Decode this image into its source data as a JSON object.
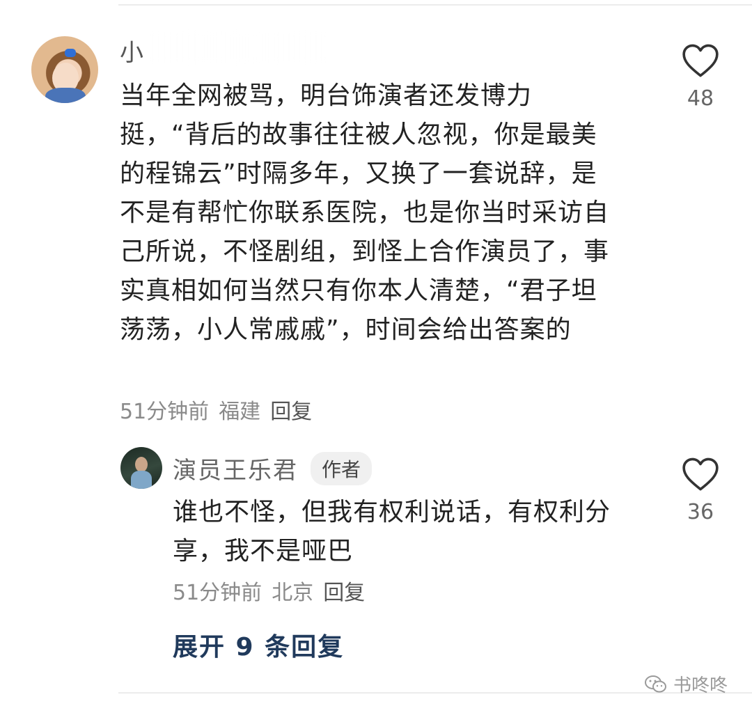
{
  "comment": {
    "username": "小",
    "text": "当年全网被骂，明台饰演者还发博力挺，“背后的故事往往被人忽视，你是最美的程锦云”时隔多年，又换了一套说辞，是不是有帮忙你联系医院，也是你当时采访自己所说，不怪剧组，到怪上合作演员了，事实真相如何当然只有你本人清楚，“君子坦荡荡，小人常戚戚”，时间会给出答案的",
    "time": "51分钟前",
    "location": "福建",
    "reply_label": "回复",
    "likes": "48"
  },
  "reply": {
    "username": "演员王乐君",
    "badge": "作者",
    "text": "谁也不怪，但我有权利说话，有权利分享，我不是哑巴",
    "time": "51分钟前",
    "location": "北京",
    "reply_label": "回复",
    "likes": "36"
  },
  "expand_label": "展开 9 条回复",
  "watermark": "书咚咚",
  "icons": {
    "like": "heart-outline-icon",
    "watermark": "wechat-icon"
  },
  "colors": {
    "expand_link": "#203a5c",
    "meta_text": "#8a8a8a"
  }
}
